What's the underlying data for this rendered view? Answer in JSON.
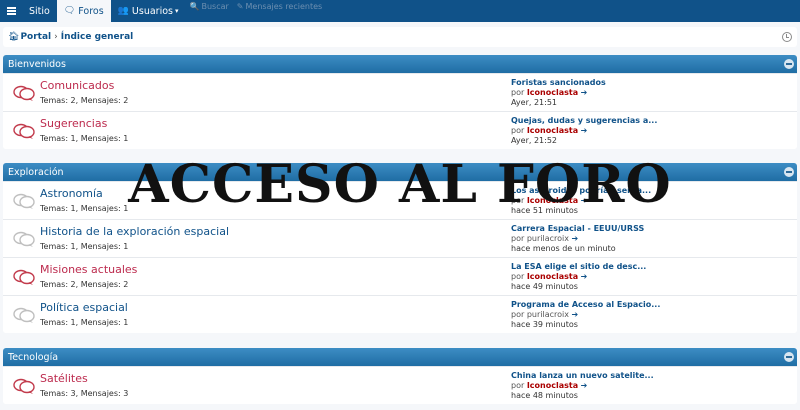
{
  "nav": {
    "items": [
      {
        "label": "Sitio",
        "icon": "",
        "active": false
      },
      {
        "label": "Foros",
        "icon": "chat-icon",
        "active": true
      },
      {
        "label": "Usuarios",
        "icon": "users-icon",
        "active": false
      }
    ],
    "faded": [
      "Buscar",
      "Mensajes recientes"
    ]
  },
  "breadcrumb": {
    "portal": "Portal",
    "index": "Índice general"
  },
  "sections": [
    {
      "title": "Bienvenidos",
      "forums": [
        {
          "name": "Comunicados",
          "unread": true,
          "stats": "Temas: 2, Mensajes: 2",
          "last_title": "Foristas sancionados",
          "by": "por",
          "user": "Iconoclasta",
          "admin": true,
          "time": "Ayer, 21:51"
        },
        {
          "name": "Sugerencias",
          "unread": true,
          "stats": "Temas: 1, Mensajes: 1",
          "last_title": "Quejas, dudas y sugerencias a...",
          "by": "por",
          "user": "Iconoclasta",
          "admin": true,
          "time": "Ayer, 21:52"
        }
      ]
    },
    {
      "title": "Exploración",
      "forums": [
        {
          "name": "Astronomía",
          "unread": false,
          "stats": "Temas: 1, Mensajes: 1",
          "last_title": "Los asteroides podrían ser la...",
          "by": "por",
          "user": "Iconoclasta",
          "admin": true,
          "time": "hace 51 minutos"
        },
        {
          "name": "Historia de la exploración espacial",
          "unread": false,
          "stats": "Temas: 1, Mensajes: 1",
          "last_title": "Carrera Espacial - EEUU/URSS",
          "by": "por",
          "user": "purilacroix",
          "admin": false,
          "time": "hace menos de un minuto"
        },
        {
          "name": "Misiones actuales",
          "unread": true,
          "stats": "Temas: 2, Mensajes: 2",
          "last_title": "La ESA elige el sitio de desc...",
          "by": "por",
          "user": "Iconoclasta",
          "admin": true,
          "time": "hace 49 minutos"
        },
        {
          "name": "Política espacial",
          "unread": false,
          "stats": "Temas: 1, Mensajes: 1",
          "last_title": "Programa de Acceso al Espacio...",
          "by": "por",
          "user": "purilacroix",
          "admin": false,
          "time": "hace 39 minutos"
        }
      ]
    },
    {
      "title": "Tecnología",
      "forums": [
        {
          "name": "Satélites",
          "unread": true,
          "stats": "Temas: 3, Mensajes: 3",
          "last_title": "China lanza un nuevo satelite...",
          "by": "por",
          "user": "Iconoclasta",
          "admin": true,
          "time": "hace 48 minutos"
        }
      ]
    }
  ],
  "overlay_text": "ACCESO AL FORO",
  "colors": {
    "nav_bg": "#105289",
    "header_bg": "#2c7bb0",
    "unread": "#bc2a4d",
    "read": "#105289",
    "admin_user": "#aa0000"
  }
}
